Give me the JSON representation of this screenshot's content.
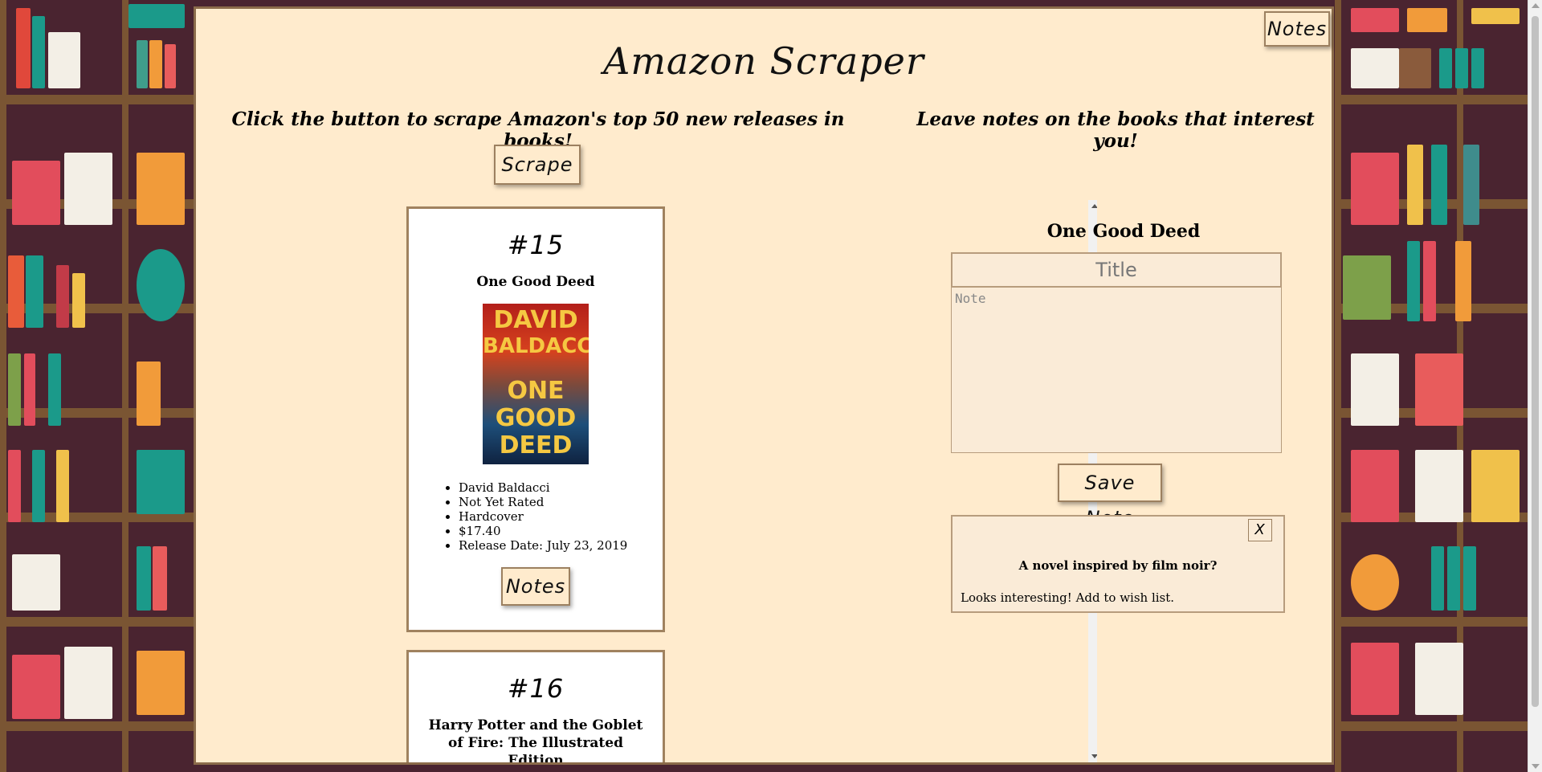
{
  "app": {
    "title": "Amazon Scraper",
    "notes_button": "Notes"
  },
  "left": {
    "subtitle": "Click the button to scrape Amazon's top 50 new releases in books!",
    "scrape_button": "Scrape"
  },
  "right": {
    "subtitle": "Leave notes on the books that interest you!",
    "selected_book": "One Good Deed",
    "title_placeholder": "Title",
    "note_placeholder": "Note",
    "save_button": "Save Note",
    "saved_note": {
      "close": "X",
      "title": "A novel inspired by film noir?",
      "body": "Looks interesting! Add to wish list."
    }
  },
  "books": [
    {
      "rank": "#15",
      "title": "One Good Deed",
      "cover": {
        "line1": "DAVID",
        "line2": "BALDACCI",
        "line3": "ONE GOOD",
        "line4": "DEED"
      },
      "details": [
        "David Baldacci",
        "Not Yet Rated",
        "Hardcover",
        "$17.40",
        "Release Date: July 23, 2019"
      ],
      "notes_button": "Notes"
    },
    {
      "rank": "#16",
      "title": "Harry Potter and the Goblet of Fire: The Illustrated Edition"
    }
  ],
  "colors": {
    "panel": "#ffebcd",
    "border": "#8b6b4a",
    "background": "#4a2430"
  }
}
